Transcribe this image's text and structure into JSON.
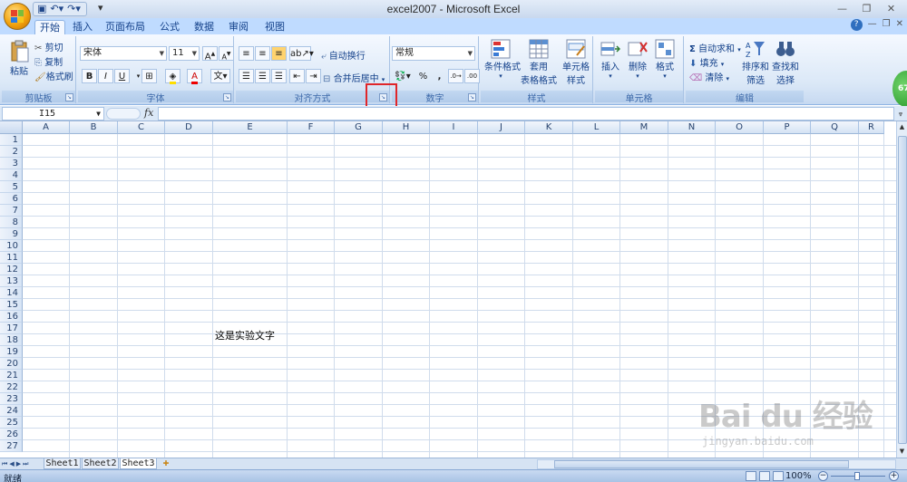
{
  "window": {
    "title": "excel2007 - Microsoft Excel"
  },
  "qat": {
    "save_icon": "save-icon",
    "undo_icon": "undo-icon",
    "redo_icon": "redo-icon",
    "customize": "▾"
  },
  "tabs": [
    {
      "label": "开始",
      "active": true
    },
    {
      "label": "插入"
    },
    {
      "label": "页面布局"
    },
    {
      "label": "公式"
    },
    {
      "label": "数据"
    },
    {
      "label": "审阅"
    },
    {
      "label": "视图"
    }
  ],
  "ribbon": {
    "clipboard": {
      "label": "剪贴板",
      "paste": "粘贴",
      "cut": "剪切",
      "copy": "复制",
      "format_painter": "格式刷"
    },
    "font": {
      "label": "字体",
      "font_name": "宋体",
      "font_size": "11",
      "bold": "B",
      "italic": "I",
      "underline": "U"
    },
    "alignment": {
      "label": "对齐方式",
      "wrap_text": "自动换行",
      "merge_center": "合并后居中"
    },
    "number": {
      "label": "数字",
      "format": "常规",
      "percent": "%",
      "comma": ","
    },
    "styles": {
      "label": "样式",
      "conditional": "条件格式",
      "table1": "套用",
      "table2": "表格格式",
      "cell1": "单元格",
      "cell2": "样式"
    },
    "cells": {
      "label": "单元格",
      "insert": "插入",
      "delete": "删除",
      "format": "格式"
    },
    "editing": {
      "label": "编辑",
      "autosum": "自动求和",
      "fill": "填充",
      "clear": "清除",
      "sort1": "排序和",
      "sort2": "筛选",
      "find1": "查找和",
      "find2": "选择"
    },
    "avatar_text": "67"
  },
  "formula_bar": {
    "name_box": "I15",
    "fx": "fx",
    "formula": ""
  },
  "grid": {
    "columns": [
      "A",
      "B",
      "C",
      "D",
      "E",
      "F",
      "G",
      "H",
      "I",
      "J",
      "K",
      "L",
      "M",
      "N",
      "O",
      "P",
      "Q",
      "R"
    ],
    "rows": [
      "1",
      "2",
      "3",
      "4",
      "5",
      "6",
      "7",
      "8",
      "9",
      "10",
      "11",
      "12",
      "13",
      "14",
      "15",
      "16",
      "17",
      "18",
      "19",
      "20",
      "21",
      "22",
      "23",
      "24",
      "25",
      "26",
      "27"
    ],
    "cell_E7": "这是实验文字"
  },
  "sheets": [
    {
      "name": "Sheet1"
    },
    {
      "name": "Sheet2"
    },
    {
      "name": "Sheet3",
      "active": true
    }
  ],
  "status": {
    "text": "就绪",
    "zoom": "100%"
  },
  "watermark": {
    "main": "Bai du 经验",
    "sub": "jingyan.baidu.com"
  },
  "colors": {
    "ribbon_bg": "#dbe8f7",
    "tab_bar": "#bfdbff",
    "highlight": "#e0262a"
  }
}
